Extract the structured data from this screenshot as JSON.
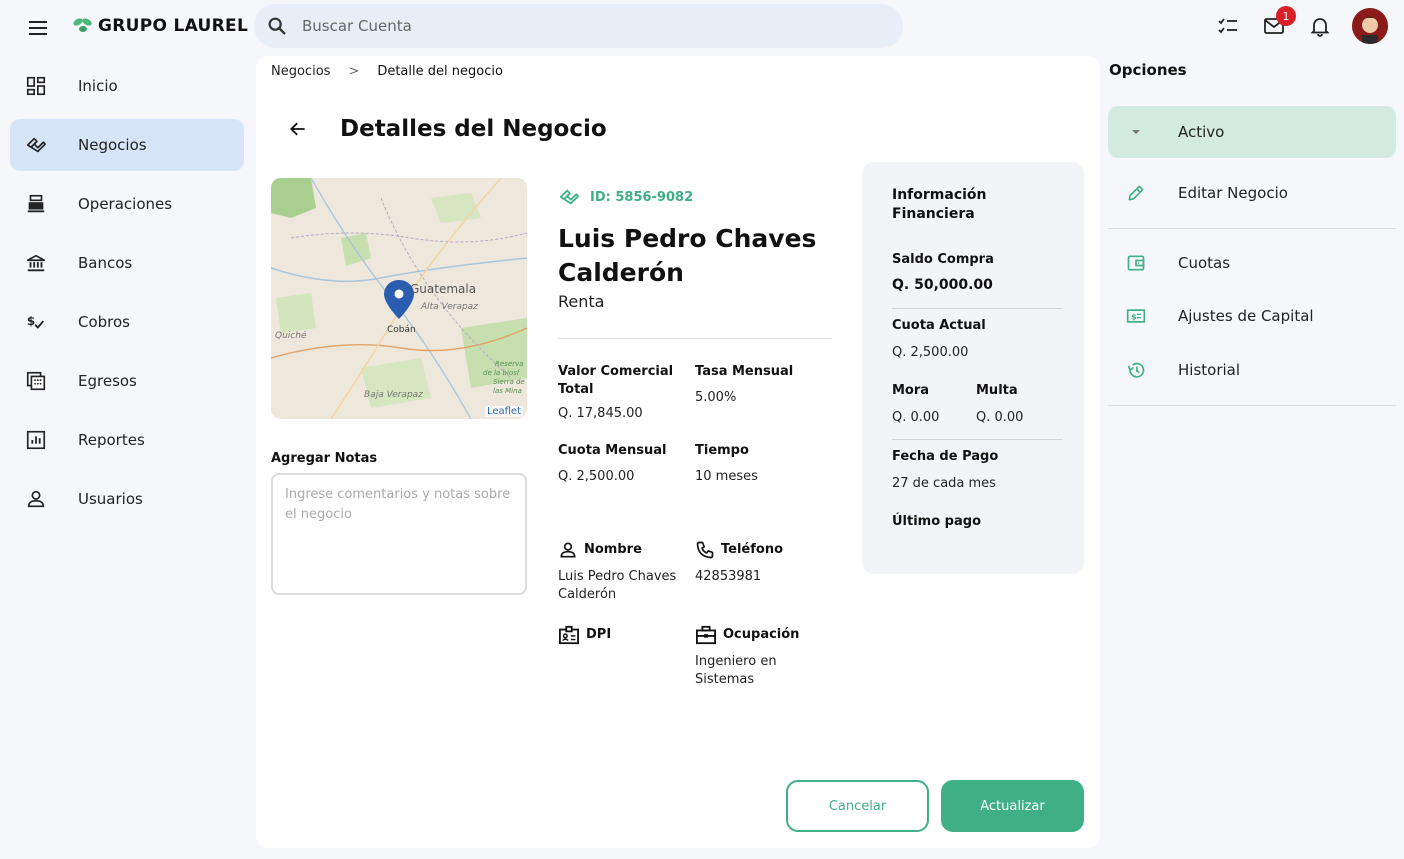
{
  "app": {
    "logo_text": "GRUPO LAUREL",
    "search_placeholder": "Buscar Cuenta",
    "mail_badge": "1"
  },
  "colors": {
    "brand": "#3fb085",
    "active_nav": "#d6e6f8",
    "active_option": "#d3ebe0",
    "badge": "#d92027"
  },
  "sidebar": {
    "items": [
      {
        "label": "Inicio",
        "icon": "dashboard-icon"
      },
      {
        "label": "Negocios",
        "icon": "handshake-icon",
        "active": true
      },
      {
        "label": "Operaciones",
        "icon": "cash-register-icon"
      },
      {
        "label": "Bancos",
        "icon": "bank-icon"
      },
      {
        "label": "Cobros",
        "icon": "payment-icon"
      },
      {
        "label": "Egresos",
        "icon": "calculator-icon"
      },
      {
        "label": "Reportes",
        "icon": "report-icon"
      },
      {
        "label": "Usuarios",
        "icon": "user-icon"
      }
    ]
  },
  "breadcrumb": {
    "parent": "Negocios",
    "separator": ">",
    "current": "Detalle del negocio"
  },
  "page": {
    "title": "Detalles del Negocio"
  },
  "map": {
    "labels": [
      "Guatemala",
      "Alta Verapaz",
      "Cobán",
      "Quiché",
      "Baja Verapaz"
    ],
    "reserve_labels": [
      "Reserva",
      "de la biosf",
      "Sierra de",
      "las Mina"
    ],
    "attribution": "Leaflet"
  },
  "notes": {
    "label": "Agregar Notas",
    "placeholder": "Ingrese comentarios y notas sobre el negocio"
  },
  "business": {
    "id": "ID: 5856-9082",
    "name": "Luis Pedro Chaves Calderón",
    "type": "Renta",
    "valor_label": "Valor Comercial Total",
    "valor_value": "Q. 17,845.00",
    "tasa_label": "Tasa Mensual",
    "tasa_value": "5.00%",
    "cuota_label": "Cuota Mensual",
    "cuota_value": "Q. 2,500.00",
    "tiempo_label": "Tiempo",
    "tiempo_value": "10 meses",
    "nombre_label": "Nombre",
    "nombre_value": "Luis Pedro Chaves Calderón",
    "telefono_label": "Teléfono",
    "telefono_value": "42853981",
    "dpi_label": "DPI",
    "ocupacion_label": "Ocupación",
    "ocupacion_value": "Ingeniero en Sistemas"
  },
  "finance": {
    "title": "Información Financiera",
    "saldo_label": "Saldo Compra",
    "saldo_value": "Q. 50,000.00",
    "cuota_label": "Cuota Actual",
    "cuota_value": "Q. 2,500.00",
    "mora_label": "Mora",
    "mora_value": "Q. 0.00",
    "multa_label": "Multa",
    "multa_value": "Q. 0.00",
    "fecha_label": "Fecha de Pago",
    "fecha_value": "27 de cada mes",
    "ultimo_label": "Último pago"
  },
  "actions": {
    "cancel": "Cancelar",
    "update": "Actualizar"
  },
  "options": {
    "title": "Opciones",
    "status": "Activo",
    "edit": "Editar Negocio",
    "cuotas": "Cuotas",
    "ajustes": "Ajustes de Capital",
    "historial": "Historial"
  }
}
